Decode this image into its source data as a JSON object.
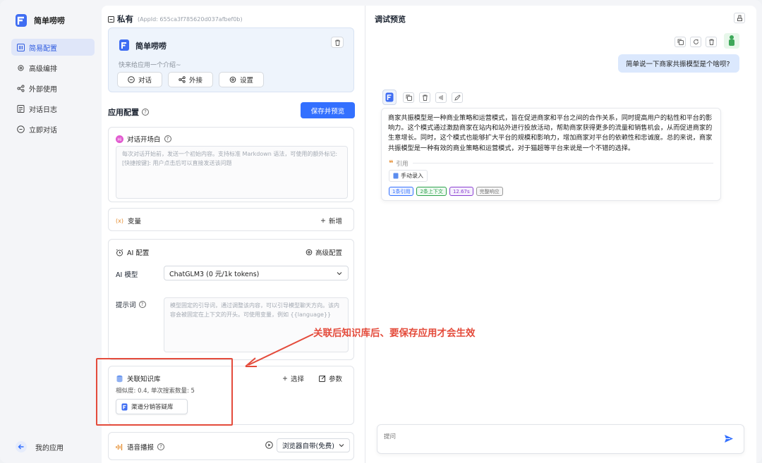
{
  "sidebar": {
    "app_title": "简单唠唠",
    "items": [
      {
        "label": "简易配置",
        "icon": "layout-icon",
        "active": true
      },
      {
        "label": "高级编排",
        "icon": "gear-icon",
        "active": false
      },
      {
        "label": "外部使用",
        "icon": "share-icon",
        "active": false
      },
      {
        "label": "对话日志",
        "icon": "log-icon",
        "active": false
      },
      {
        "label": "立即对话",
        "icon": "chat-icon",
        "active": false
      }
    ],
    "my_apps": "我的应用"
  },
  "config": {
    "header_title": "私有",
    "app_id": "(AppId: 655ca3f785620d037afbef0b)",
    "app_name": "简单唠唠",
    "app_desc": "快来给应用一个介绍~",
    "buttons": {
      "chat": "对话",
      "share": "外接",
      "settings": "设置"
    },
    "section_title": "应用配置",
    "save_button": "保存并预览",
    "opening": {
      "title": "对话开场白",
      "placeholder": "每次对话开始前，发送一个初始内容。支持标准 Markdown 语法，可使用的额外标记:\n[快捷按键]: 用户点击后可以直接发送该问题"
    },
    "variables": {
      "title": "变量",
      "add": "新增"
    },
    "ai": {
      "title": "AI 配置",
      "advanced": "高级配置",
      "model_label": "AI 模型",
      "model_value": "ChatGLM3 (0 元/1k tokens)",
      "prompt_label": "提示词",
      "prompt_placeholder": "模型固定的引导词，通过调整该内容，可以引导模型聊天方向。该内容会被固定在上下文的开头。可使用变量，例如 {{language}}"
    },
    "kb": {
      "title": "关联知识库",
      "select": "选择",
      "params": "参数",
      "info": "相似度: 0.4, 单次搜索数量: 5",
      "item": "渠道分销答疑库"
    },
    "tts": {
      "title": "语音播报",
      "value": "浏览器自带(免费)"
    }
  },
  "annotation": "关联后知识库后、要保存应用才会生效",
  "preview": {
    "title": "调试预览",
    "user_message": "简单说一下商家共振模型是个啥呗?",
    "answer": "商家共振模型是一种商业策略和运营模式，旨在促进商家和平台之间的合作关系，同时提高用户的粘性和平台的影响力。这个模式通过激励商家在站内和站外进行投放活动，帮助商家获得更多的流量和销售机会，从而促进商家的生意增长。同时，这个模式也能够扩大平台的规模和影响力，增加商家对平台的依赖性和忠诚度。总的来说，商家共振模型是一种有效的商业策略和运营模式，对于猫超等平台来说是一个不错的选择。",
    "cite_label": "引用",
    "source": "手动录入",
    "tags": [
      {
        "label": "1条引用",
        "color": "#3370ff"
      },
      {
        "label": "2条上下文",
        "color": "#2ca24c"
      },
      {
        "label": "12.67s",
        "color": "#8a3fd1"
      },
      {
        "label": "完整响应",
        "color": "#777777"
      }
    ],
    "input_placeholder": "提问"
  },
  "colors": {
    "primary": "#3370ff",
    "annotation": "#e44b3b"
  }
}
